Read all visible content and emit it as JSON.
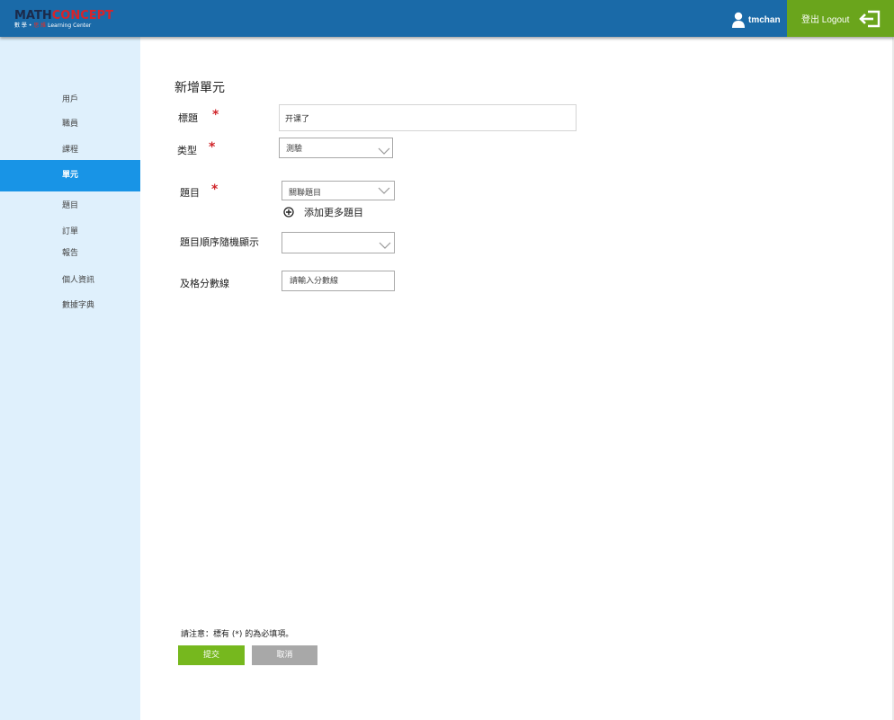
{
  "header": {
    "logo": {
      "math": "MATH",
      "concept": "CONCEPT",
      "sub_prefix": "數 學 •",
      "sub_red": "思 維",
      "sub_suffix": "Learning Center"
    },
    "user_name": "tmchan",
    "logout_label": "登出 Logout",
    "colors": {
      "bar": "#1a6aa8",
      "logout": "#6aa51c"
    }
  },
  "sidebar": {
    "items": [
      {
        "label": "用戶",
        "active": false
      },
      {
        "label": "職員",
        "active": false
      },
      {
        "label": "課程",
        "active": false
      },
      {
        "label": "單元",
        "active": true
      },
      {
        "label": "題目",
        "active": false
      },
      {
        "label": "訂單",
        "active": false
      },
      {
        "label": "報告",
        "active": false
      },
      {
        "label": "個人資訊",
        "active": false
      },
      {
        "label": "數據字典",
        "active": false
      }
    ],
    "colors": {
      "background": "#dff0fc",
      "active": "#1894e6"
    }
  },
  "form": {
    "title": "新增單元",
    "fields": {
      "title": {
        "label": "標題",
        "required_mark": "*",
        "value": "开课了"
      },
      "type": {
        "label": "类型",
        "required_mark": "*",
        "value": "測驗"
      },
      "question": {
        "label": "題目",
        "required_mark": "*",
        "value": "關聯題目"
      },
      "add_more": "添加更多題目",
      "random_order": {
        "label": "題目順序隨機顯示",
        "value": ""
      },
      "passing_score": {
        "label": "及格分數線",
        "placeholder": "請輸入分數線"
      }
    },
    "note": "請注意：標有 (*) 的為必填項。",
    "submit_label": "提交",
    "cancel_label": "取消",
    "colors": {
      "required": "#d0252a",
      "submit": "#76b81e",
      "cancel": "#a8a8a8"
    }
  }
}
